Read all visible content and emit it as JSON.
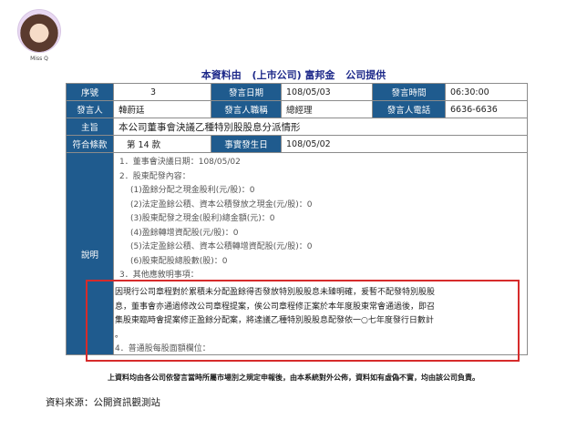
{
  "avatar": {
    "name": "Miss Q"
  },
  "header": {
    "part1": "本資料由",
    "part2": "(上市公司) 富邦金",
    "part3": "公司提供"
  },
  "rows": {
    "r1": {
      "l1": "序號",
      "v1": "3",
      "l2": "發言日期",
      "v2": "108/05/03",
      "l3": "發言時間",
      "v3": "06:30:00"
    },
    "r2": {
      "l1": "發言人",
      "v1": "韓蔚廷",
      "l2": "發言人職稱",
      "v2": "總經理",
      "l3": "發言人電話",
      "v3": "6636-6636"
    },
    "r3": {
      "l1": "主旨",
      "v1": "本公司董事會決議乙種特別股股息分派情形"
    },
    "r4": {
      "l1": "符合條款",
      "v1": "第 14 款",
      "l2": "事實發生日",
      "v2": "108/05/02"
    },
    "r5": {
      "l1": "說明"
    }
  },
  "detail": {
    "lines": [
      "1．董事會決議日期：108/05/02",
      "2．股東配發內容：",
      "(1)盈餘分配之現金股利(元/股)：0",
      "(2)法定盈餘公積、資本公積發放之現金(元/股)：0",
      "(3)股東配發之現金(股利)總金額(元)：0",
      "(4)盈餘轉增資配股(元/股)：0",
      "(5)法定盈餘公積、資本公積轉增資配股(元/股)：0",
      "(6)股東配股總股數(股)：0",
      "3．其他應敘明事項："
    ],
    "highlight_lines": [
      "因現行公司章程對於累積未分配盈餘得否發放特別股股息未臻明確，爰暫不配發特別股股",
      "息，董事會亦通過修改公司章程提案，俟公司章程修正案於本年度股東常會通過後，即召",
      "集股東臨時會提案修正盈餘分配案，將達議乙種特別股股息配發依一○七年度發行日數計",
      "。",
      "4．普通股每股面額欄位："
    ]
  },
  "footnote": "上資料均由各公司依發言當時所屬市場別之規定申報後，由本系統對外公佈，資料如有虛偽不實，均由該公司負責。",
  "source": "資料來源：公開資訊觀測站"
}
